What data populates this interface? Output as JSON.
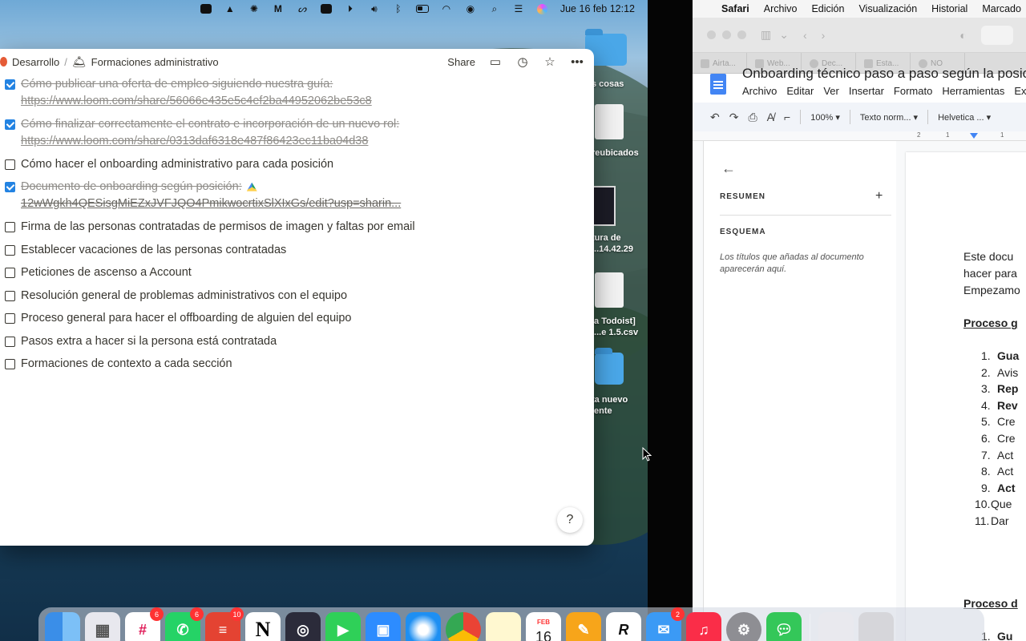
{
  "menubar": {
    "datetime": "Jue 16 feb  12:12"
  },
  "desktop": {
    "items": [
      {
        "label": "s cosas"
      },
      {
        "label": "reubicados"
      },
      {
        "label": "tura de ...14.42.29"
      },
      {
        "label": "la Todoist] l...e 1.5.csv"
      },
      {
        "label": "ta nuevo iente"
      }
    ]
  },
  "notion": {
    "breadcrumb": [
      "Desarrollo",
      "/",
      "Formaciones administrativo"
    ],
    "share_label": "Share",
    "todos": [
      {
        "text": "Cómo publicar una oferta de empleo siguiendo nuestra guía:",
        "link": "https://www.loom.com/share/56066e435e5c4ef2ba44952062be53c8",
        "checked": true
      },
      {
        "text": "Cómo finalizar correctamente el contrato e incorporación de un nuevo rol:",
        "link": "https://www.loom.com/share/0313daf6318e487f86423ec11ba04d38",
        "checked": true
      },
      {
        "text": "Cómo hacer el onboarding administrativo para cada posición",
        "checked": false
      },
      {
        "text": "Documento de onboarding según posición:",
        "link": "12wWgkh4QESisgMiEZxJVFJQO4PmikwocrtixSlXIxGs/edit?usp=sharin...",
        "checked": true
      },
      {
        "text": "Firma de las personas contratadas de permisos de imagen y faltas por email",
        "checked": false
      },
      {
        "text": "Establecer vacaciones de las personas contratadas",
        "checked": false
      },
      {
        "text": "Peticiones de ascenso a Account",
        "checked": false
      },
      {
        "text": "Resolución general de problemas administrativos con el equipo",
        "checked": false
      },
      {
        "text": "Proceso general para hacer el offboarding de alguien del equipo",
        "checked": false
      },
      {
        "text": "Pasos extra a hacer si la persona está contratada",
        "checked": false
      },
      {
        "text": "Formaciones de contexto a cada sección",
        "checked": false
      }
    ],
    "help_label": "?"
  },
  "safari": {
    "menu": [
      "Safari",
      "Archivo",
      "Edición",
      "Visualización",
      "Historial",
      "Marcado"
    ],
    "tabs": [
      "Airta...",
      "Web...",
      "Dec...",
      "Esta...",
      "NO"
    ]
  },
  "docs": {
    "title": "Onboarding técnico paso a paso según la posició",
    "menu": [
      "Archivo",
      "Editar",
      "Ver",
      "Insertar",
      "Formato",
      "Herramientas",
      "Ex"
    ],
    "toolbar": {
      "zoom": "100%",
      "style": "Texto norm...",
      "font": "Helvetica ..."
    },
    "outline": {
      "summary_label": "RESUMEN",
      "outline_label": "ESQUEMA",
      "note": "Los títulos que añadas al documento aparecerán aquí."
    },
    "page": {
      "intro": [
        "Este docu",
        "hacer para",
        "Empezamo"
      ],
      "heading1": "Proceso g",
      "list": [
        {
          "num": "1.",
          "text": "Gua",
          "bold": true
        },
        {
          "num": "2.",
          "text": "Avis",
          "bold": false
        },
        {
          "num": "3.",
          "text": "Rep",
          "bold": true
        },
        {
          "num": "4.",
          "text": "Rev",
          "bold": true
        },
        {
          "num": "5.",
          "text": "Cre",
          "bold": false
        },
        {
          "num": "6.",
          "text": "Cre",
          "bold": false
        },
        {
          "num": "7.",
          "text": "Act",
          "bold": false
        },
        {
          "num": "8.",
          "text": "Act",
          "bold": false
        },
        {
          "num": "9.",
          "text": "Act",
          "bold": true
        },
        {
          "num": "10.",
          "text": "Que",
          "bold": false
        },
        {
          "num": "11.",
          "text": "Dar",
          "bold": false
        }
      ],
      "heading2": "Proceso d",
      "list2_first": {
        "num": "1.",
        "text": "Gu"
      }
    }
  },
  "dock": {
    "badges": {
      "slack": "6",
      "whatsapp": "6",
      "todoist": "10",
      "mail": "2",
      "calendar_month": "FEB",
      "calendar_day": "16"
    }
  }
}
